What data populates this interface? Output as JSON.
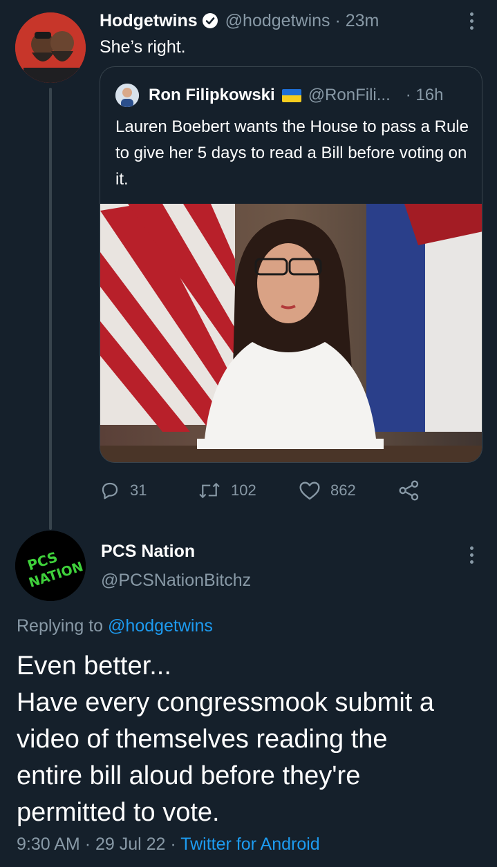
{
  "tweet": {
    "author_name": "Hodgetwins",
    "handle": "@hodgetwins",
    "time": "23m",
    "text": "She’s right.",
    "quoted": {
      "author_name": "Ron Filipkowski",
      "handle": "@RonFili...",
      "time": "16h",
      "text": "Lauren Boebert wants the House to pass a Rule to give her 5 days to read a Bill before voting on it."
    },
    "stats": {
      "replies": "31",
      "retweets": "102",
      "likes": "862"
    }
  },
  "reply": {
    "author_name": "PCS Nation",
    "handle": "@PCSNationBitchz",
    "replying_prefix": "Replying to",
    "replying_to": "@hodgetwins",
    "lines": [
      "Even better...",
      "Have every congressmook submit a",
      "video of themselves reading the",
      "entire bill aloud before they're",
      "permitted to vote."
    ],
    "time": "9:30 AM",
    "date": "29 Jul 22",
    "source": "Twitter for Android",
    "avatar_text": [
      "PCS",
      "NATION"
    ]
  },
  "colors": {
    "background": "#15202b",
    "muted": "#8899a6",
    "link": "#1d9bf0",
    "border": "#38444d"
  },
  "icons": [
    "verified-badge-icon",
    "more-options-icon",
    "reply-icon",
    "retweet-icon",
    "like-icon",
    "share-icon",
    "ukraine-flag-icon"
  ]
}
